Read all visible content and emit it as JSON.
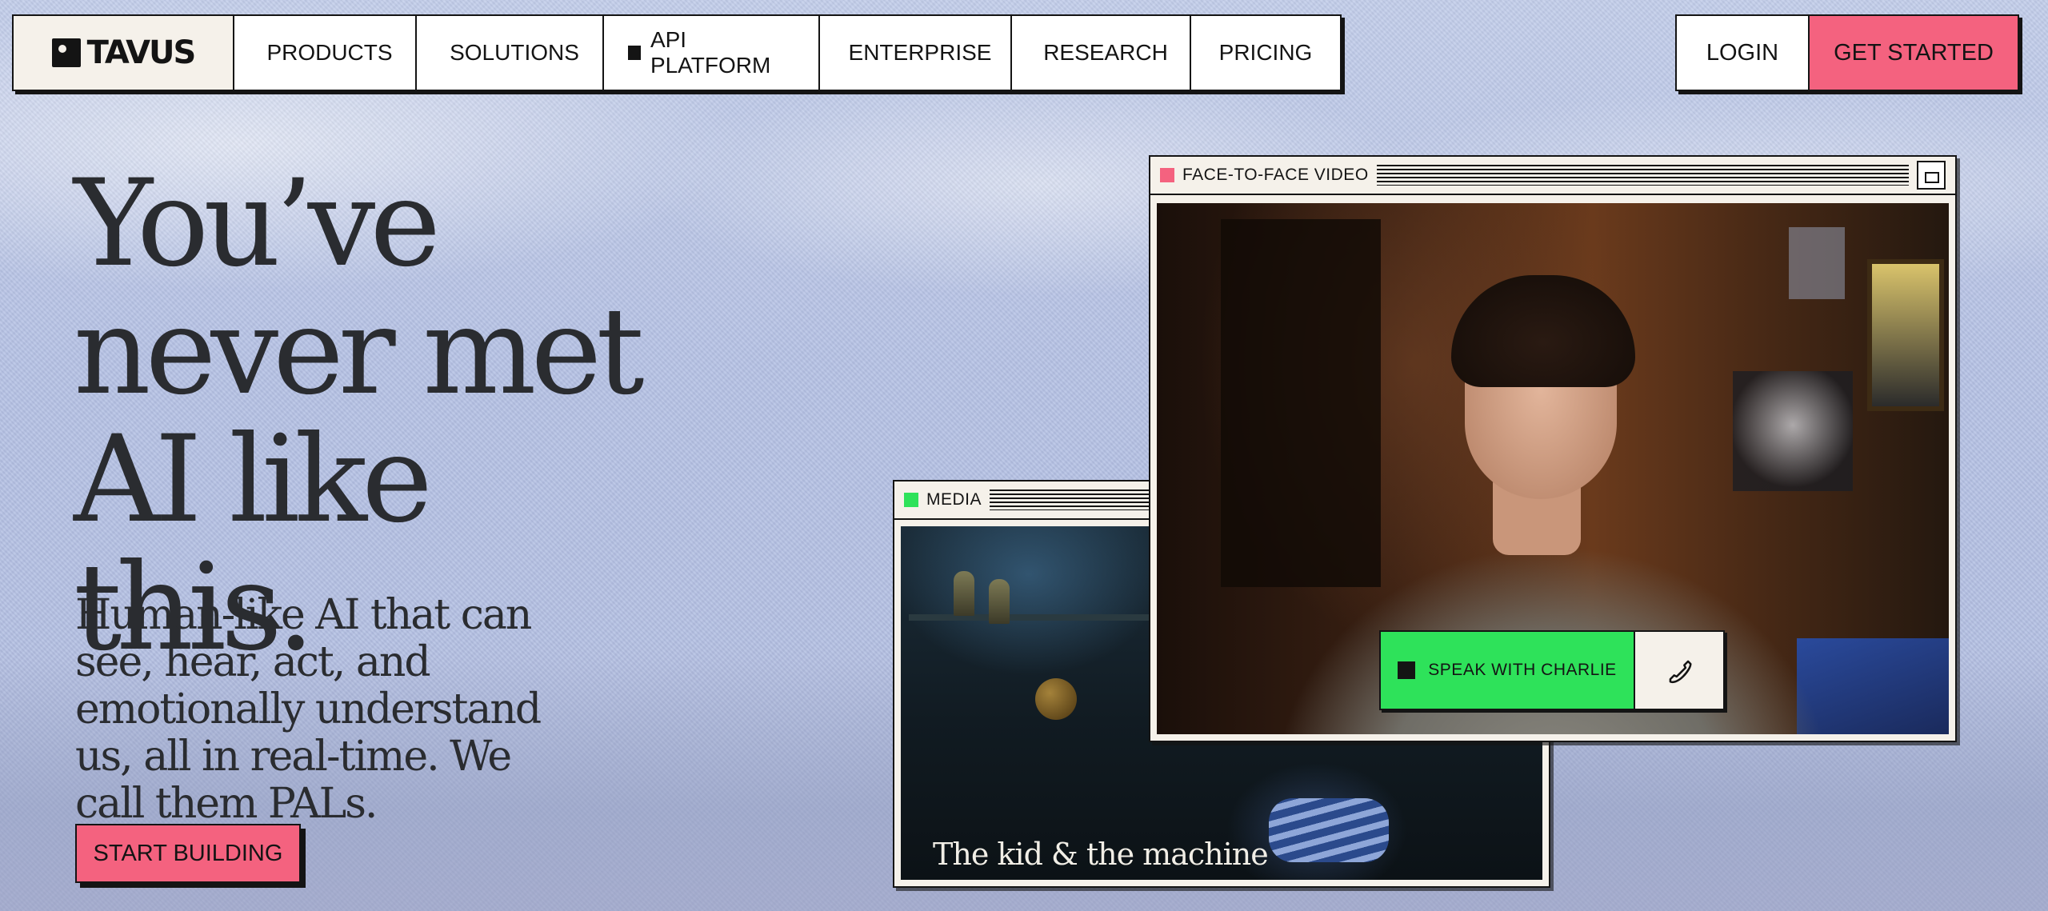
{
  "nav": {
    "logo": "TAVUS",
    "items": [
      {
        "label": "PRODUCTS",
        "marker": true
      },
      {
        "label": "SOLUTIONS",
        "marker": true
      },
      {
        "label": "API PLATFORM",
        "marker": true
      },
      {
        "label": "ENTERPRISE",
        "marker": true
      },
      {
        "label": "RESEARCH",
        "marker": true
      },
      {
        "label": "PRICING",
        "marker": false
      }
    ],
    "login": "LOGIN",
    "get_started": "GET STARTED"
  },
  "hero": {
    "headline_line1": "You’ve",
    "headline_line2": "never met",
    "headline_line3": "AI like this.",
    "subhead": "Human-like AI that can see, hear, act, and emotionally understand us, all in real-time. We call them PALs.",
    "cta": "START BUILDING"
  },
  "media_window": {
    "title": "MEDIA",
    "caption": "The kid & the machine",
    "dot_color": "#2ee25a"
  },
  "video_window": {
    "title": "FACE-TO-FACE VIDEO",
    "dot_color": "#f4627f",
    "speak_button": "SPEAK WITH CHARLIE",
    "call_icon": "phone-icon"
  },
  "colors": {
    "accent_pink": "#f4627f",
    "accent_green": "#2ee25a",
    "ink": "#141414",
    "cream": "#f5f1ea"
  }
}
